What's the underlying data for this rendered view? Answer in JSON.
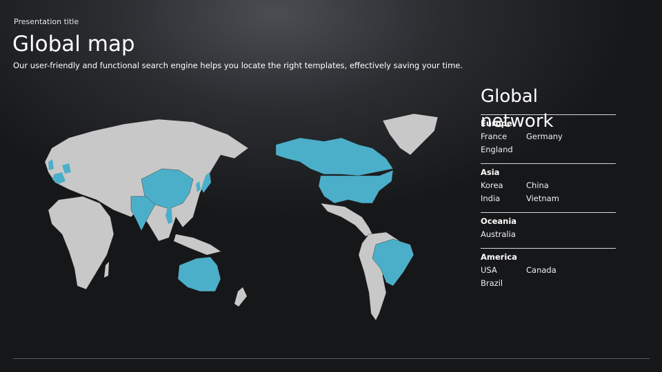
{
  "slide": {
    "presentation_title": "Presentation title",
    "title": "Global map",
    "subtitle": "Our user-friendly and functional search engine helps you locate the right templates, effectively saving your time."
  },
  "colors": {
    "highlight": "#4cafca",
    "land": "#c8c8c8"
  },
  "network": {
    "title": "Global network",
    "regions": [
      {
        "name": "Europe",
        "countries": [
          "France",
          "Germany",
          "England"
        ]
      },
      {
        "name": "Asia",
        "countries": [
          "Korea",
          "China",
          "India",
          "Vietnam"
        ]
      },
      {
        "name": "Oceania",
        "countries": [
          "Australia"
        ]
      },
      {
        "name": "America",
        "countries": [
          "USA",
          "Canada",
          "Brazil"
        ]
      }
    ]
  }
}
